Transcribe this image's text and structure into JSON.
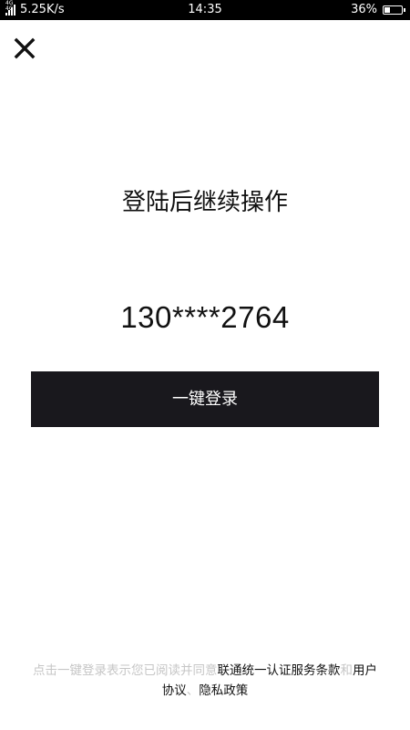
{
  "status_bar": {
    "network_tag": "4G 4G",
    "speed": "5.25K/s",
    "time": "14:35",
    "battery_percent": "36%",
    "battery_level": 0.36
  },
  "main": {
    "title": "登陆后继续操作",
    "phone_masked": "130****2764",
    "login_button_label": "一键登录"
  },
  "agreement": {
    "prefix": "点击一键登录表示您已阅读并同意",
    "service_terms": "联通统一认证服务条款",
    "and": "和",
    "user_agreement": "用户协议",
    "separator": "、",
    "privacy_policy": "隐私政策"
  },
  "colors": {
    "status_bar_bg": "#000000",
    "button_bg": "#19181d",
    "muted_text": "#c6c6c6",
    "text": "#111111"
  },
  "icons": {
    "close": "close-icon",
    "signal": "signal-icon",
    "battery": "battery-icon"
  }
}
